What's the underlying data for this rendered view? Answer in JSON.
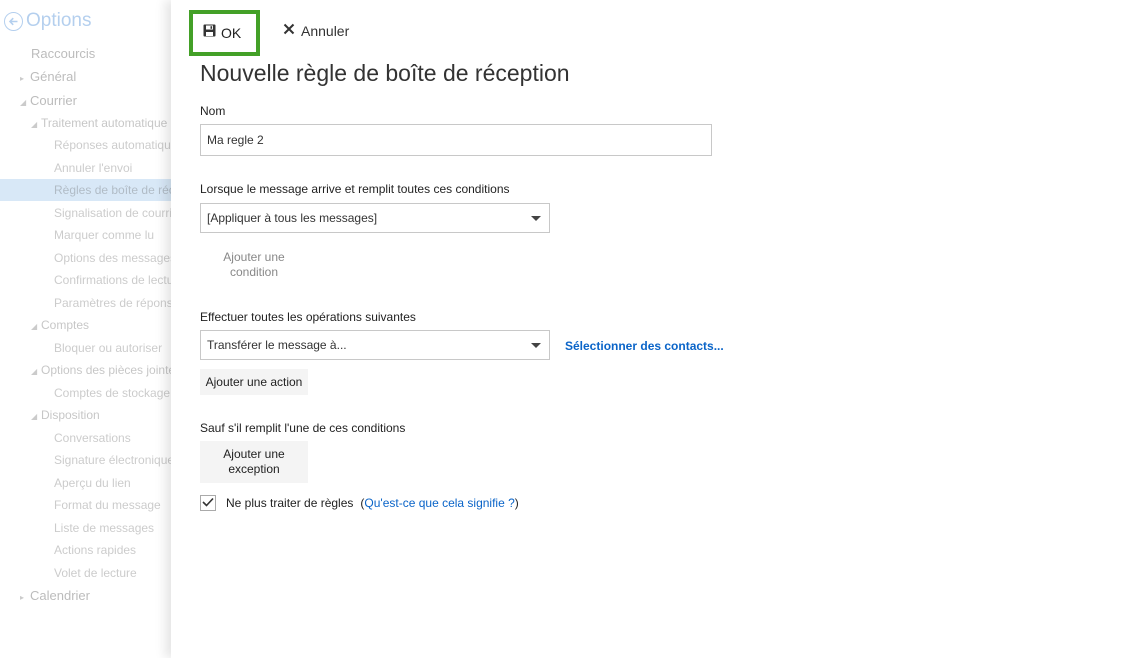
{
  "sidebar": {
    "title": "Options",
    "items": [
      {
        "label": "Raccourcis"
      },
      {
        "label": "Général"
      },
      {
        "label": "Courrier"
      },
      {
        "label": "Traitement automatique"
      },
      {
        "label": "Réponses automatiques"
      },
      {
        "label": "Annuler l'envoi"
      },
      {
        "label": "Règles de boîte de réception"
      },
      {
        "label": "Signalisation de courrier"
      },
      {
        "label": "Marquer comme lu"
      },
      {
        "label": "Options des messages"
      },
      {
        "label": "Confirmations de lecture"
      },
      {
        "label": "Paramètres de réponse"
      },
      {
        "label": "Comptes"
      },
      {
        "label": "Bloquer ou autoriser"
      },
      {
        "label": "Options des pièces jointes"
      },
      {
        "label": "Comptes de stockage"
      },
      {
        "label": "Disposition"
      },
      {
        "label": "Conversations"
      },
      {
        "label": "Signature électronique"
      },
      {
        "label": "Aperçu du lien"
      },
      {
        "label": "Format du message"
      },
      {
        "label": "Liste de messages"
      },
      {
        "label": "Actions rapides"
      },
      {
        "label": "Volet de lecture"
      },
      {
        "label": "Calendrier"
      }
    ]
  },
  "toolbar": {
    "ok_label": "OK",
    "cancel_label": "Annuler"
  },
  "dialog": {
    "title": "Nouvelle règle de boîte de réception",
    "name_label": "Nom",
    "name_value": "Ma regle 2",
    "conditions_label": "Lorsque le message arrive et remplit toutes ces conditions",
    "condition_select": "[Appliquer à tous les messages]",
    "add_condition_line1": "Ajouter une",
    "add_condition_line2": "condition",
    "actions_label": "Effectuer toutes les opérations suivantes",
    "action_select": "Transférer le message à...",
    "select_contacts_link": "Sélectionner des contacts...",
    "add_action": "Ajouter une action",
    "exceptions_label": "Sauf s'il remplit l'une de ces conditions",
    "add_exception_line1": "Ajouter une",
    "add_exception_line2": "exception",
    "stop_rules_label": "Ne plus traiter de règles",
    "help_open": "(",
    "help_link": "Qu'est-ce que cela signifie ?",
    "help_close": ")",
    "stop_rules_checked": true
  },
  "colors": {
    "accent": "#0a64c8",
    "ok_highlight": "#43a027",
    "button_gray": "#f4f4f4"
  },
  "icons": {
    "back": "back-arrow-circle-icon",
    "save": "save-icon",
    "cancel": "close-icon",
    "dropdown": "chevron-down-icon",
    "check": "checkmark-icon"
  }
}
